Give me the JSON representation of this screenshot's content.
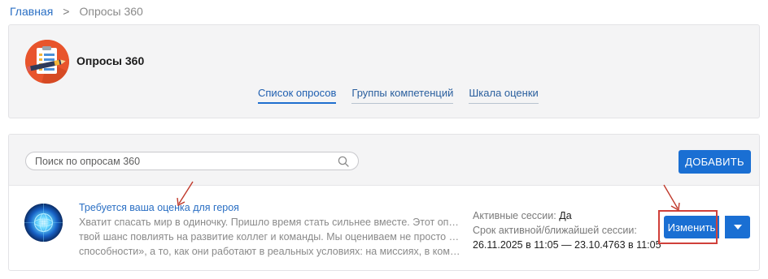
{
  "breadcrumb": {
    "home": "Главная",
    "separator": ">",
    "current": "Опросы 360"
  },
  "header": {
    "title": "Опросы 360",
    "tabs": [
      {
        "label": "Список опросов",
        "active": true
      },
      {
        "label": "Группы компетенций",
        "active": false
      },
      {
        "label": "Шкала оценки",
        "active": false
      }
    ]
  },
  "toolbar": {
    "search_placeholder": "Поиск по опросам 360",
    "add_label": "ДОБАВИТЬ"
  },
  "survey": {
    "title": "Требуется ваша оценка для героя",
    "description_lines": [
      "Хватит спасать мир в одиночку. Пришло время стать сильнее вместе. Этот опрос —",
      "твой шанс повлиять на развитие коллег и команды. Мы оцениваем не просто «крутые",
      "способности», а то, как они работают в реальных условиях: на миссиях, в командных…"
    ],
    "active_sessions_label": "Активные сессии:",
    "active_sessions_value": "Да",
    "session_period_label": "Срок активной/ближайшей сессии:",
    "session_period_value": "26.11.2025 в 11:05 — 23.10.4763 в 11:05",
    "edit_label": "Изменить"
  },
  "colors": {
    "primary": "#1a6fd3",
    "link": "#2a6fc4",
    "annotation": "#d0403a",
    "logo_bg": "#e8542c"
  },
  "icons": {
    "search": "search-icon",
    "dropdown": "caret-down-icon",
    "logo": "survey-clipboard-logo"
  }
}
